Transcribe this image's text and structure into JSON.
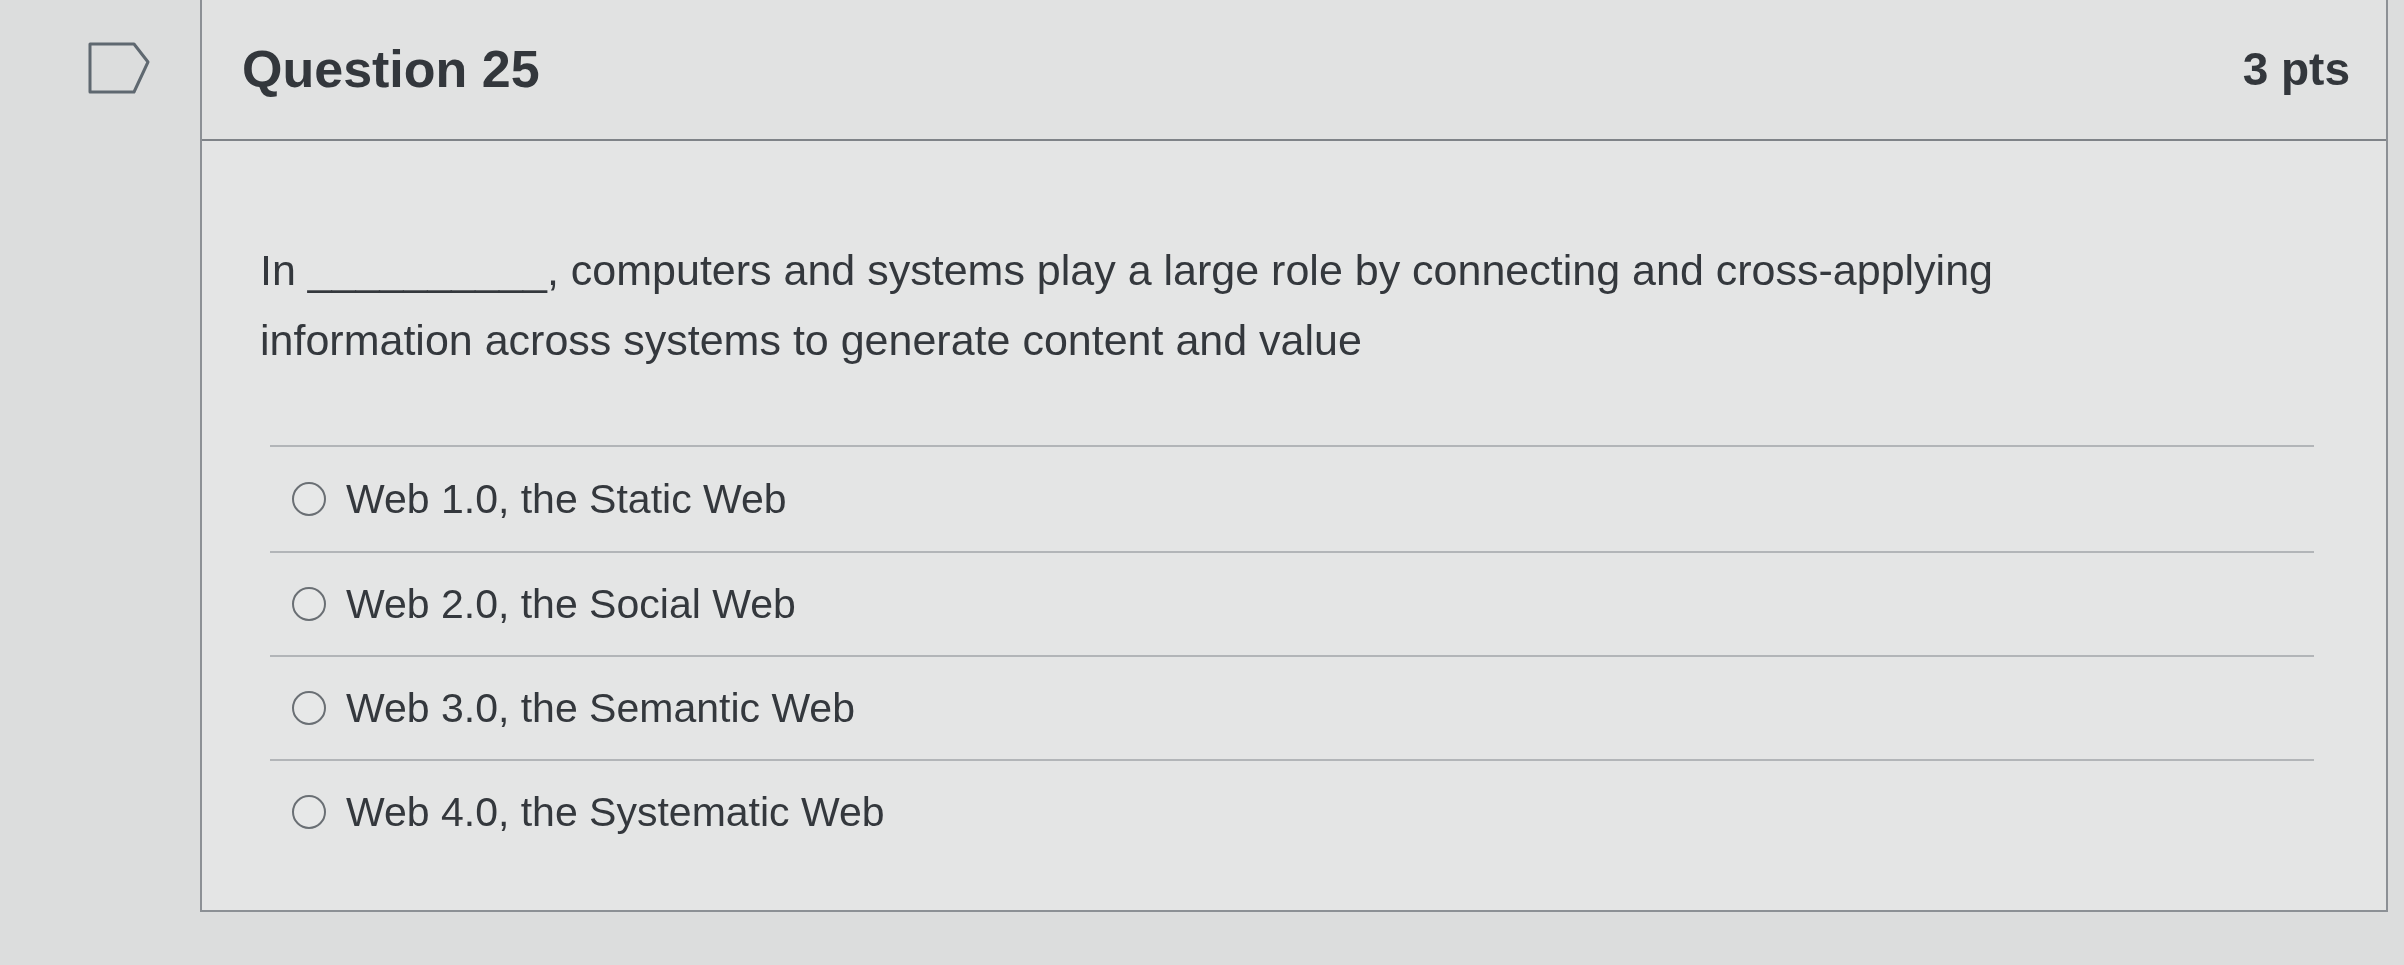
{
  "flag": {
    "flagged": false
  },
  "question": {
    "title": "Question 25",
    "points": "3 pts",
    "text": "In __________, computers and systems play a large role by connecting and cross-applying information across systems to generate content and value",
    "answers": [
      {
        "label": "Web 1.0, the Static Web",
        "selected": false
      },
      {
        "label": "Web 2.0, the Social Web",
        "selected": false
      },
      {
        "label": "Web 3.0, the Semantic Web",
        "selected": false
      },
      {
        "label": "Web 4.0, the Systematic Web",
        "selected": false
      }
    ]
  }
}
